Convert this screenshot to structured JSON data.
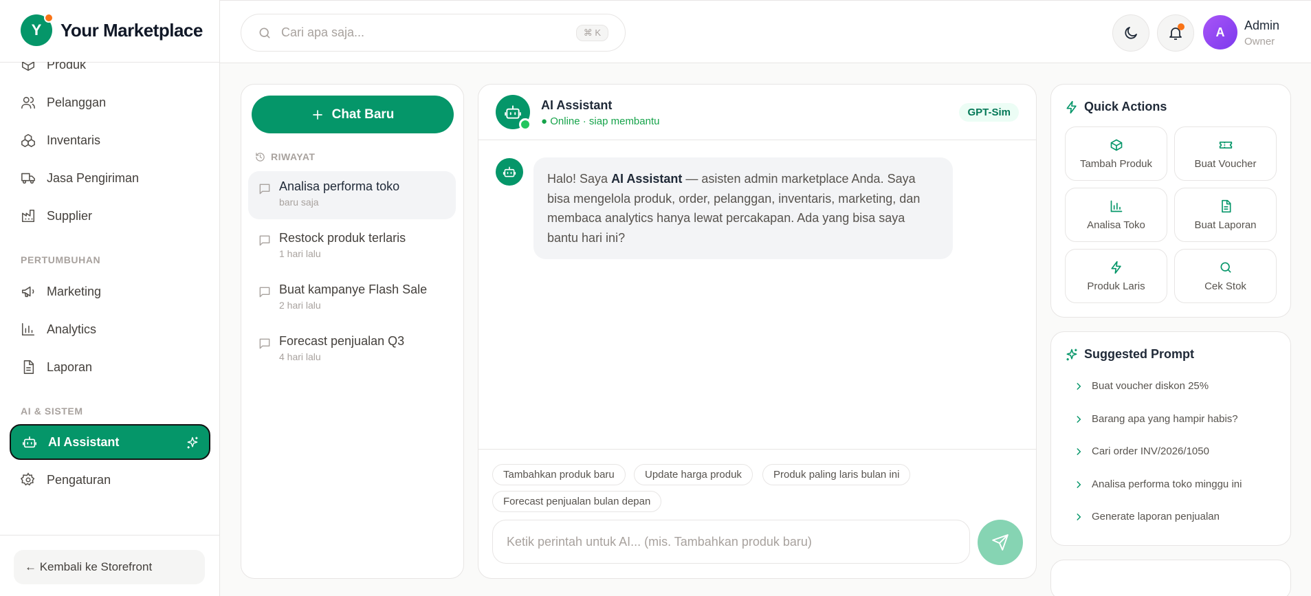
{
  "brand": {
    "initial": "Y",
    "name": "Your Marketplace"
  },
  "sidebar": {
    "items": [
      {
        "label": "Produk",
        "icon": "box-icon"
      },
      {
        "label": "Pelanggan",
        "icon": "users-icon"
      },
      {
        "label": "Inventaris",
        "icon": "boxes-icon"
      },
      {
        "label": "Jasa Pengiriman",
        "icon": "truck-icon"
      },
      {
        "label": "Supplier",
        "icon": "factory-icon"
      }
    ],
    "section_growth": "PERTUMBUHAN",
    "growth_items": [
      {
        "label": "Marketing",
        "icon": "megaphone-icon"
      },
      {
        "label": "Analytics",
        "icon": "bar-chart-icon"
      },
      {
        "label": "Laporan",
        "icon": "file-text-icon"
      }
    ],
    "section_ai": "AI & SISTEM",
    "ai_items": [
      {
        "label": "AI Assistant",
        "icon": "bot-icon",
        "active": true
      },
      {
        "label": "Pengaturan",
        "icon": "gear-icon"
      }
    ],
    "back_label": "← Kembali ke Storefront"
  },
  "header": {
    "search_placeholder": "Cari apa saja...",
    "shortcut": "⌘ K",
    "user_initial": "A",
    "user_name": "Admin",
    "user_role": "Owner"
  },
  "history": {
    "new_chat_label": "Chat Baru",
    "section_label": "RIWAYAT",
    "items": [
      {
        "title": "Analisa performa toko",
        "time": "baru saja",
        "selected": true
      },
      {
        "title": "Restock produk terlaris",
        "time": "1 hari lalu"
      },
      {
        "title": "Buat kampanye Flash Sale",
        "time": "2 hari lalu"
      },
      {
        "title": "Forecast penjualan Q3",
        "time": "4 hari lalu"
      }
    ]
  },
  "chat": {
    "title": "AI Assistant",
    "status": "● Online · siap membantu",
    "model": "GPT-Sim",
    "message_pre": "Halo! Saya ",
    "message_bold": "AI Assistant",
    "message_post": " — asisten admin marketplace Anda. Saya bisa mengelola produk, order, pelanggan, inventaris, marketing, dan membaca analytics hanya lewat percakapan. Ada yang bisa saya bantu hari ini?",
    "chips": [
      "Tambahkan produk baru",
      "Update harga produk",
      "Produk paling laris bulan ini",
      "Forecast penjualan bulan depan"
    ],
    "input_placeholder": "Ketik perintah untuk AI... (mis. Tambahkan produk baru)"
  },
  "quick_actions": {
    "title": "Quick Actions",
    "items": [
      {
        "label": "Tambah Produk",
        "icon": "box-icon"
      },
      {
        "label": "Buat Voucher",
        "icon": "ticket-icon"
      },
      {
        "label": "Analisa Toko",
        "icon": "bar-chart-icon"
      },
      {
        "label": "Buat Laporan",
        "icon": "file-text-icon"
      },
      {
        "label": "Produk Laris",
        "icon": "zap-icon"
      },
      {
        "label": "Cek Stok",
        "icon": "search-icon"
      }
    ]
  },
  "suggested": {
    "title": "Suggested Prompt",
    "items": [
      "Buat voucher diskon 25%",
      "Barang apa yang hampir habis?",
      "Cari order INV/2026/1050",
      "Analisa performa toko minggu ini",
      "Generate laporan penjualan"
    ]
  },
  "colors": {
    "primary": "#059669",
    "accent": "#f97316",
    "online": "#22c55e"
  }
}
